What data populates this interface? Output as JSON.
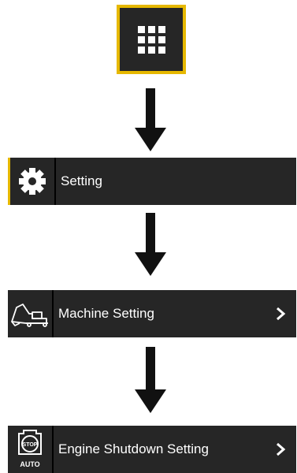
{
  "menu": {
    "icon": "grid-menu-icon",
    "highlight_color": "#e6b800"
  },
  "steps": [
    {
      "label": "Setting",
      "icon": "gear-icon"
    },
    {
      "label": "Machine Setting",
      "icon": "excavator-icon"
    },
    {
      "label": "Engine Shutdown Setting",
      "icon": "engine-stop-icon"
    }
  ],
  "engine_icon": {
    "top_text": "STOP",
    "bottom_text": "AUTO"
  }
}
